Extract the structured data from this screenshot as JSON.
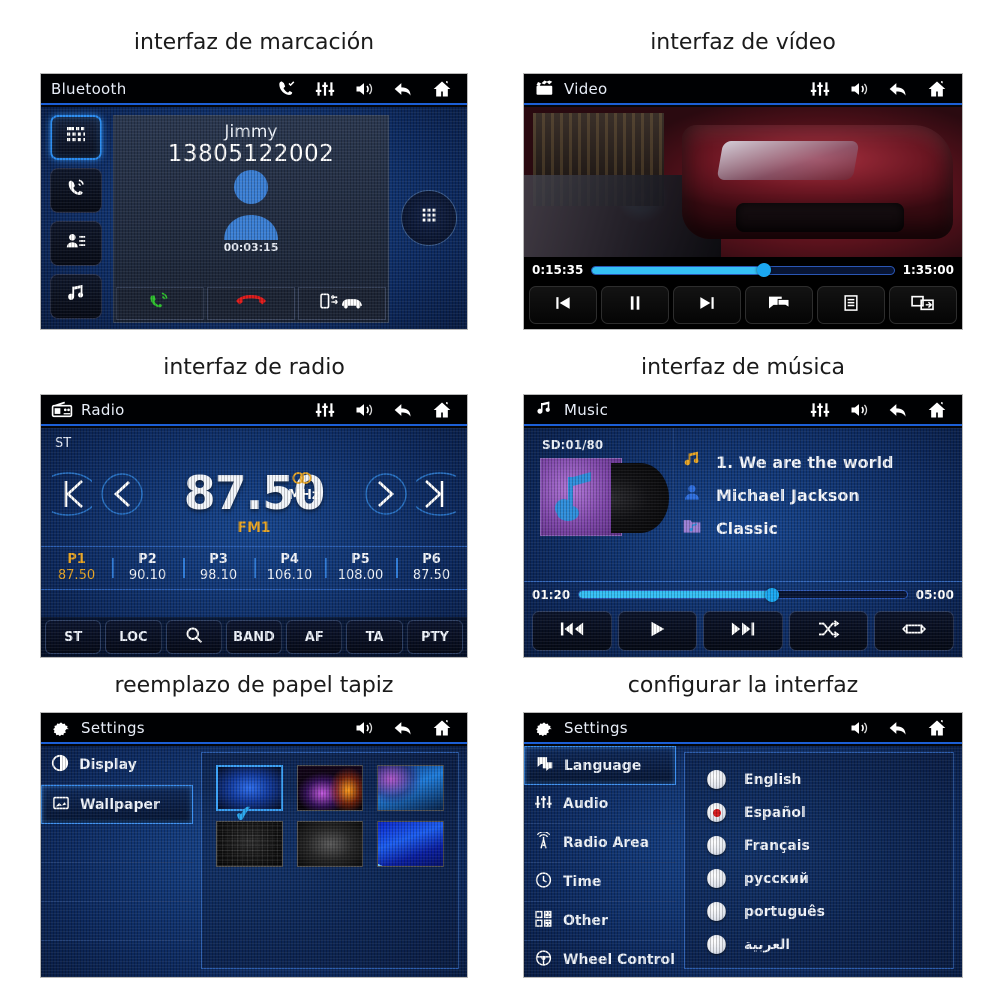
{
  "captions": {
    "dialing": "interfaz de marcación",
    "video": "interfaz de vídeo",
    "radio": "interfaz de radio",
    "music": "interfaz de música",
    "wallpaper": "reemplazo de papel tapiz",
    "settings": "configurar la interfaz"
  },
  "bluetooth": {
    "title": "Bluetooth",
    "title_icons": [
      "phone-check-icon",
      "equalizer-icon",
      "volume-icon",
      "back-icon",
      "home-icon"
    ],
    "side_buttons": [
      {
        "name": "keypad-icon",
        "active": true
      },
      {
        "name": "call-history-icon",
        "active": false
      },
      {
        "name": "contacts-icon",
        "active": false
      },
      {
        "name": "music-note-icon",
        "active": false
      }
    ],
    "contact_name": "Jimmy",
    "phone_number": "13805122002",
    "call_timer": "00:03:15",
    "actions": [
      "answer-call-icon",
      "end-call-icon",
      "transfer-to-car-icon"
    ],
    "keypad_round": "keypad-icon"
  },
  "video": {
    "title": "Video",
    "title_icon": "clapperboard-icon",
    "title_icons": [
      "equalizer-icon",
      "volume-icon",
      "back-icon",
      "home-icon"
    ],
    "elapsed": "0:15:35",
    "duration": "1:35:00",
    "progress_percent": 57,
    "controls": [
      "previous-icon",
      "pause-icon",
      "next-icon",
      "subtitle-icon",
      "playlist-icon",
      "screen-switch-icon"
    ]
  },
  "radio": {
    "title": "Radio",
    "title_icon": "radio-icon",
    "title_icons": [
      "equalizer-icon",
      "volume-icon",
      "back-icon",
      "home-icon"
    ],
    "stereo_label": "ST",
    "frequency": "87.50",
    "unit": "MHz",
    "band": "FM1",
    "nav_icons": [
      "skip-prev-icon",
      "step-prev-icon",
      "step-next-icon",
      "skip-next-icon"
    ],
    "presets": [
      {
        "slot": "P1",
        "freq": "87.50",
        "selected": true
      },
      {
        "slot": "P2",
        "freq": "90.10",
        "selected": false
      },
      {
        "slot": "P3",
        "freq": "98.10",
        "selected": false
      },
      {
        "slot": "P4",
        "freq": "106.10",
        "selected": false
      },
      {
        "slot": "P5",
        "freq": "108.00",
        "selected": false
      },
      {
        "slot": "P6",
        "freq": "87.50",
        "selected": false
      }
    ],
    "buttons": [
      "ST",
      "LOC",
      "search-icon",
      "BAND",
      "AF",
      "TA",
      "PTY"
    ]
  },
  "music": {
    "title": "Music",
    "title_icon": "music-note-icon",
    "title_icons": [
      "equalizer-icon",
      "volume-icon",
      "back-icon",
      "home-icon"
    ],
    "source": "SD:01/80",
    "track": "1.  We are the world",
    "artist": "Michael Jackson",
    "album": "Classic",
    "elapsed": "01:20",
    "duration": "05:00",
    "progress_percent": 59,
    "controls": [
      "previous-icon",
      "play-icon",
      "next-icon",
      "shuffle-icon",
      "repeat-icon"
    ]
  },
  "wallpaper_settings": {
    "title": "Settings",
    "title_icon": "gear-icon",
    "title_icons": [
      "volume-icon",
      "back-icon",
      "home-icon"
    ],
    "sidebar": [
      {
        "label": "Display",
        "icon": "contrast-icon",
        "selected": false
      },
      {
        "label": "Wallpaper",
        "icon": "image-icon",
        "selected": true
      },
      {
        "label": "",
        "icon": "",
        "selected": false
      },
      {
        "label": "",
        "icon": "",
        "selected": false
      },
      {
        "label": "",
        "icon": "",
        "selected": false
      },
      {
        "label": "",
        "icon": "",
        "selected": false
      }
    ],
    "thumbnails": [
      {
        "id": "wallpaper-1",
        "selected": true
      },
      {
        "id": "wallpaper-2",
        "selected": false
      },
      {
        "id": "wallpaper-3",
        "selected": false
      },
      {
        "id": "wallpaper-4",
        "selected": false
      },
      {
        "id": "wallpaper-5",
        "selected": false
      },
      {
        "id": "wallpaper-6",
        "selected": false
      }
    ],
    "check_glyph": "✔"
  },
  "language_settings": {
    "title": "Settings",
    "title_icon": "gear-icon",
    "title_icons": [
      "volume-icon",
      "back-icon",
      "home-icon"
    ],
    "sidebar": [
      {
        "label": "Language",
        "icon": "speech-bubble-icon",
        "selected": true
      },
      {
        "label": "Audio",
        "icon": "equalizer-icon",
        "selected": false
      },
      {
        "label": "Radio Area",
        "icon": "antenna-icon",
        "selected": false
      },
      {
        "label": "Time",
        "icon": "clock-icon",
        "selected": false
      },
      {
        "label": "Other",
        "icon": "grid-icon",
        "selected": false
      },
      {
        "label": "Wheel Control",
        "icon": "steering-wheel-icon",
        "selected": false
      }
    ],
    "languages": [
      {
        "label": "English",
        "selected": false
      },
      {
        "label": "Español",
        "selected": true
      },
      {
        "label": "Français",
        "selected": false
      },
      {
        "label": "русский",
        "selected": false
      },
      {
        "label": "português",
        "selected": false
      },
      {
        "label": "العربية",
        "selected": false
      }
    ]
  },
  "colors": {
    "accent_blue": "#2b8cf0",
    "track_blue": "#35c0f5",
    "amber": "#e8a627",
    "call_green": "#2fc12f",
    "hangup_red": "#e01b1b",
    "radio_selected": "#d4191c"
  }
}
